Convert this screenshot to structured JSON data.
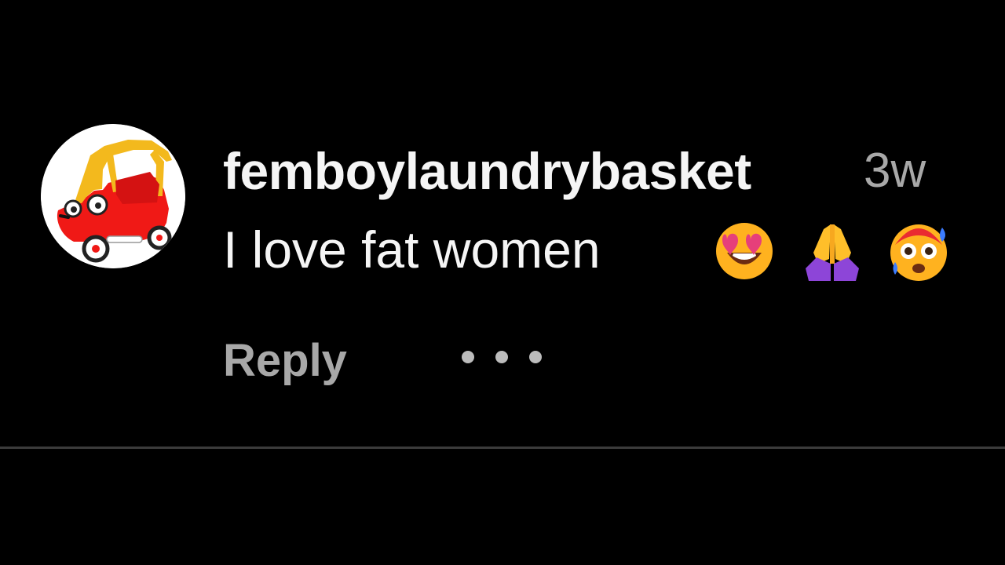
{
  "comment": {
    "username": "femboylaundrybasket",
    "timestamp": "3w",
    "text": "I love fat women",
    "emojis": [
      {
        "name": "heart-eyes-emoji",
        "label": "🤩"
      },
      {
        "name": "folded-hands-emoji",
        "label": "🙏"
      },
      {
        "name": "flushed-emoji",
        "label": "😳"
      }
    ],
    "reply_label": "Reply",
    "more_icon": "more-options-icon",
    "avatar_icon": "toy-car-avatar"
  },
  "colors": {
    "background": "#000000",
    "primary_text": "#f5f5f5",
    "secondary_text": "#a8a8a8",
    "divider": "#3b3b3b"
  }
}
